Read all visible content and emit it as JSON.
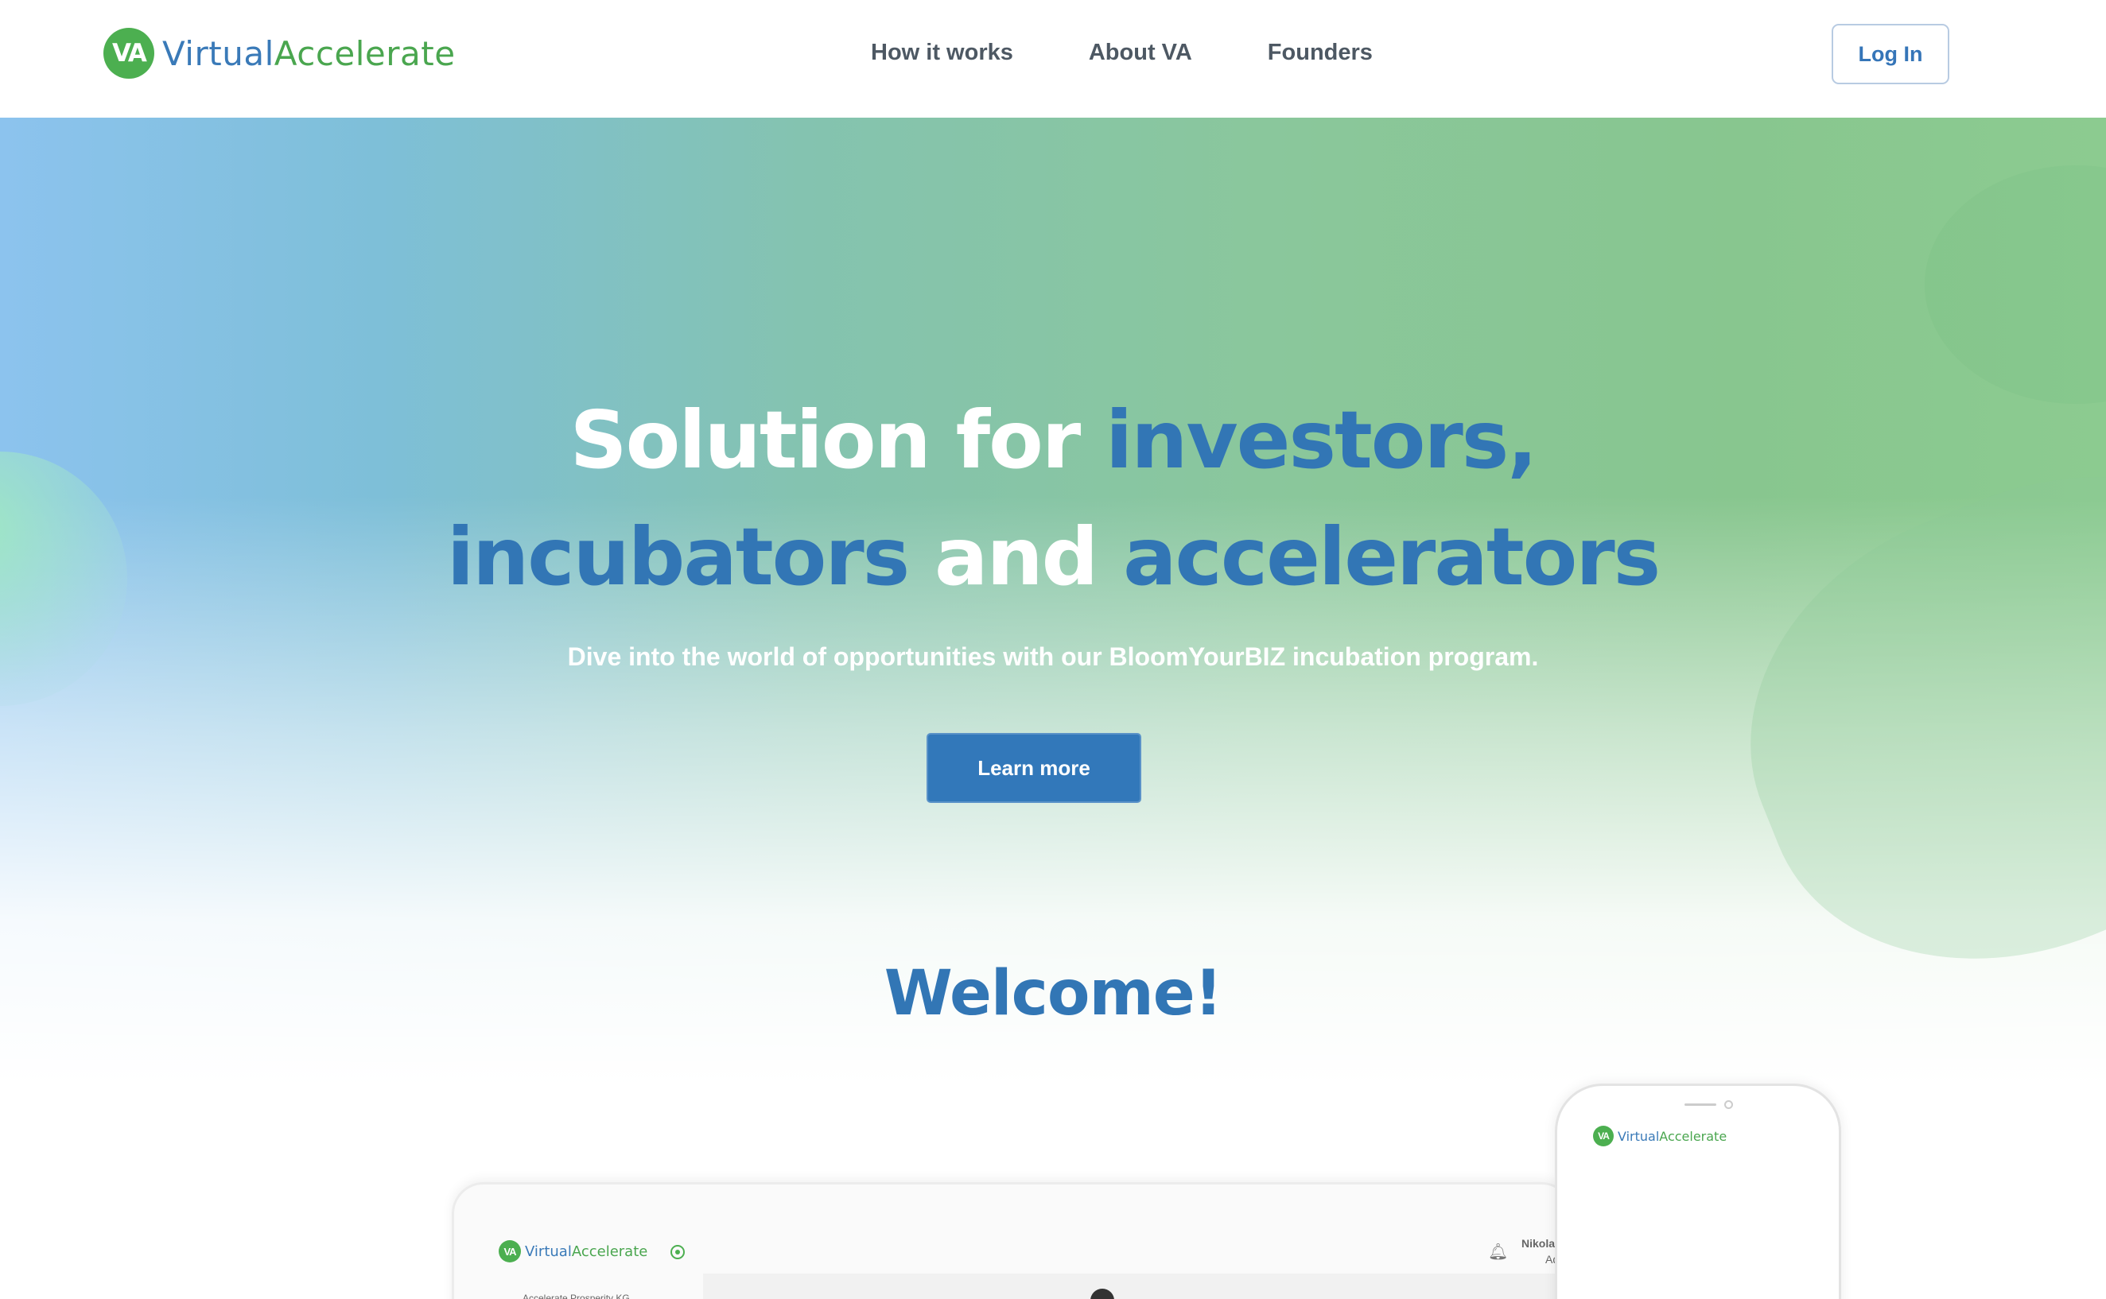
{
  "brand": {
    "badge": "VA",
    "name_part1": "Virtual",
    "name_part2": "Accelerate"
  },
  "nav": {
    "links": [
      "How it works",
      "About VA",
      "Founders"
    ],
    "login_label": "Log In"
  },
  "hero": {
    "headline_line1": {
      "part1": "Solution for ",
      "part2": "investors",
      "part3": ","
    },
    "headline_line2": {
      "part1": "incubators",
      "part2": " and ",
      "part3": "accelerators"
    },
    "subline": "Dive into the world of opportunities with our BloomYourBIZ incubation program.",
    "cta_label": "Learn more",
    "welcome": "Welcome!"
  },
  "mockup": {
    "laptop": {
      "org": "Accelerate Prosperity KG",
      "user_name": "Nikola",
      "user_role": "Ad"
    }
  },
  "colors": {
    "accent_blue": "#3276b5",
    "accent_green": "#4caf50"
  }
}
